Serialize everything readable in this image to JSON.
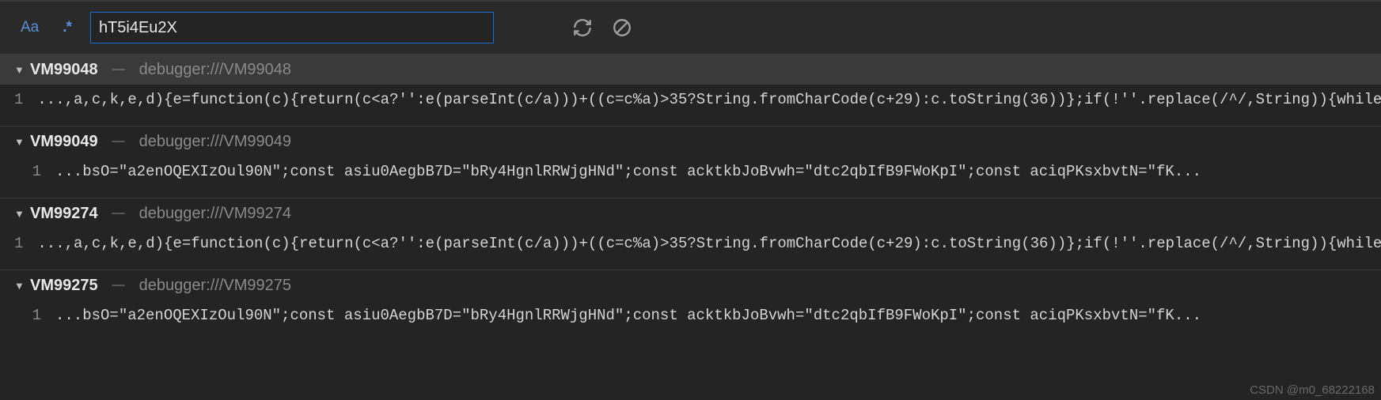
{
  "toolbar": {
    "case_label": "Aa",
    "regex_label": ".*",
    "search_value": "hT5i4Eu2X"
  },
  "results": [
    {
      "name": "VM99048",
      "path": "debugger:///VM99048",
      "selected": true,
      "lines": [
        {
          "num": "1",
          "text": "...,a,c,k,e,d){e=function(c){return(c<a?'':e(parseInt(c/a)))+((c=c%a)>35?String.fromCharCode(c+29):c.toString(36))};if(!''.replace(/^/,String)){while(."
        }
      ]
    },
    {
      "name": "VM99049",
      "path": "debugger:///VM99049",
      "selected": false,
      "lines": [
        {
          "num": "1",
          "text": "...bsO=\"a2enOQEXIzOul90N\";const asiu0AegbB7D=\"bRy4HgnlRRWjgHNd\";const acktkbJoBvwh=\"dtc2qbIfB9FWoKpI\";const aciqPKsxbvtN=\"fK..."
        }
      ]
    },
    {
      "name": "VM99274",
      "path": "debugger:///VM99274",
      "selected": false,
      "lines": [
        {
          "num": "1",
          "text": "...,a,c,k,e,d){e=function(c){return(c<a?'':e(parseInt(c/a)))+((c=c%a)>35?String.fromCharCode(c+29):c.toString(36))};if(!''.replace(/^/,String)){while(."
        }
      ]
    },
    {
      "name": "VM99275",
      "path": "debugger:///VM99275",
      "selected": false,
      "lines": [
        {
          "num": "1",
          "text": "...bsO=\"a2enOQEXIzOul90N\";const asiu0AegbB7D=\"bRy4HgnlRRWjgHNd\";const acktkbJoBvwh=\"dtc2qbIfB9FWoKpI\";const aciqPKsxbvtN=\"fK..."
        }
      ]
    }
  ],
  "watermark": "CSDN @m0_68222168"
}
